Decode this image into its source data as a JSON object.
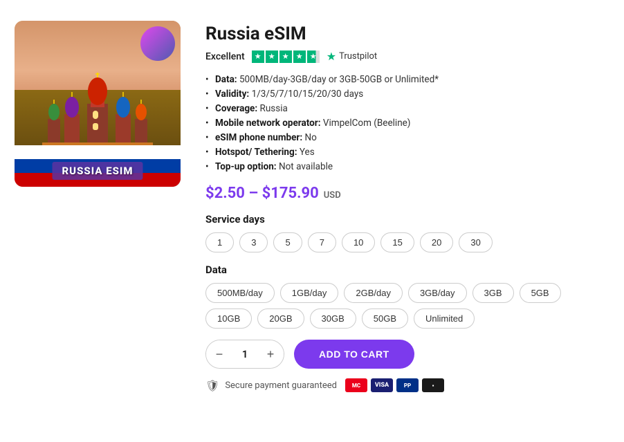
{
  "product": {
    "title": "Russia eSIM",
    "image_label": "RUSSIA ESIM",
    "trustpilot": {
      "label": "Excellent",
      "brand": "Trustpilot",
      "rating": 4.5
    },
    "specs": [
      {
        "key": "Data",
        "value": "500MB/day-3GB/day or 3GB-50GB or Unlimited*"
      },
      {
        "key": "Validity",
        "value": "1/3/5/7/10/15/20/30 days"
      },
      {
        "key": "Coverage",
        "value": "Russia"
      },
      {
        "key": "Mobile network operator",
        "value": "VimpelCom (Beeline)"
      },
      {
        "key": "eSIM phone number",
        "value": "No"
      },
      {
        "key": "Hotspot/ Tethering",
        "value": "Yes"
      },
      {
        "key": "Top-up option",
        "value": "Not available"
      }
    ],
    "price_range": "$2.50 – $175.90",
    "currency": "USD",
    "service_days_label": "Service days",
    "service_days": [
      "1",
      "3",
      "5",
      "7",
      "10",
      "15",
      "20",
      "30"
    ],
    "data_label": "Data",
    "data_options": [
      "500MB/day",
      "1GB/day",
      "2GB/day",
      "3GB/day",
      "3GB",
      "5GB",
      "10GB",
      "20GB",
      "30GB",
      "50GB",
      "Unlimited"
    ],
    "quantity": "1",
    "add_to_cart_label": "ADD TO CART",
    "secure_label": "Secure payment guaranteed"
  }
}
